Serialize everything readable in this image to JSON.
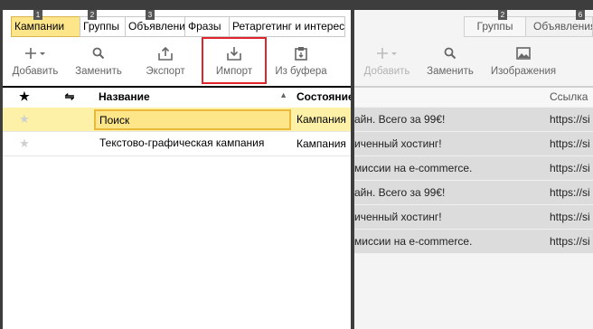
{
  "left": {
    "tabs": [
      {
        "label": "Кампании",
        "badge": "1",
        "active": true
      },
      {
        "label": "Группы",
        "badge": "2",
        "active": false
      },
      {
        "label": "Объявления",
        "badge": "3",
        "active": false
      },
      {
        "label": "Фразы",
        "badge": "4",
        "active": false
      },
      {
        "label": "Ретаргетинг и интересы",
        "badge": "5",
        "active": false
      }
    ],
    "toolbar": {
      "add": "Добавить",
      "replace": "Заменить",
      "export": "Экспорт",
      "import": "Импорт",
      "from_buffer": "Из буфера"
    },
    "header": {
      "star": "★",
      "sync": "⇋",
      "name": "Название",
      "sort": "▲",
      "status": "Состояние"
    },
    "rows": [
      {
        "name": "Поиск",
        "status": "Кампания"
      },
      {
        "name": "Текстово-графическая кампания",
        "status": "Кампания"
      }
    ]
  },
  "right": {
    "tabs": [
      {
        "label": "Группы",
        "badge": "2"
      },
      {
        "label": "Объявления",
        "badge": "6"
      }
    ],
    "toolbar": {
      "add": "Добавить",
      "replace": "Заменить",
      "images": "Изображения"
    },
    "header": {
      "link": "Ссылка"
    },
    "rows": [
      {
        "text": "айн. Всего за 99€!",
        "link": "https://si"
      },
      {
        "text": "иченный хостинг!",
        "link": "https://si"
      },
      {
        "text": "миссии на e-commerce.",
        "link": "https://si"
      },
      {
        "text": "айн. Всего за 99€!",
        "link": "https://si"
      },
      {
        "text": "иченный хостинг!",
        "link": "https://si"
      },
      {
        "text": "миссии на e-commerce.",
        "link": "https://si"
      }
    ]
  },
  "colors": {
    "active_tab": "#fde58a",
    "selected_row": "#fdf1a8",
    "highlight_outline": "#e0242a",
    "background": "#3d3d3d"
  }
}
